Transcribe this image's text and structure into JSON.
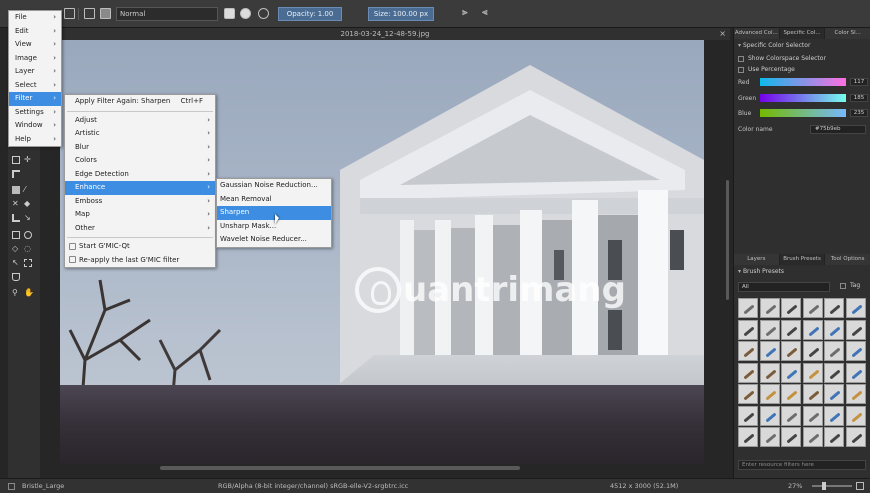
{
  "toolbar": {
    "blend_mode": "Normal",
    "opacity_label": "Opacity: 1.00",
    "size_label": "Size: 100.00 px"
  },
  "document": {
    "title": "2018-03-24_12-48-59.jpg"
  },
  "main_menu": {
    "items": [
      {
        "label": "File"
      },
      {
        "label": "Edit"
      },
      {
        "label": "View"
      },
      {
        "label": "Image"
      },
      {
        "label": "Layer"
      },
      {
        "label": "Select"
      },
      {
        "label": "Filter"
      },
      {
        "label": "Settings"
      },
      {
        "label": "Window"
      },
      {
        "label": "Help"
      }
    ],
    "selected": "Filter"
  },
  "filter_menu": {
    "apply_again": "Apply Filter Again: Sharpen",
    "apply_again_shortcut": "Ctrl+F",
    "items": [
      {
        "label": "Adjust"
      },
      {
        "label": "Artistic"
      },
      {
        "label": "Blur"
      },
      {
        "label": "Colors"
      },
      {
        "label": "Edge Detection"
      },
      {
        "label": "Enhance"
      },
      {
        "label": "Emboss"
      },
      {
        "label": "Map"
      },
      {
        "label": "Other"
      }
    ],
    "gmic_items": [
      {
        "label": "Start G'MIC-Qt"
      },
      {
        "label": "Re-apply the last G'MIC filter"
      }
    ]
  },
  "enhance_menu": {
    "items": [
      {
        "label": "Gaussian Noise Reduction..."
      },
      {
        "label": "Mean Removal"
      },
      {
        "label": "Sharpen"
      },
      {
        "label": "Unsharp Mask..."
      },
      {
        "label": "Wavelet Noise Reducer..."
      }
    ],
    "selected": "Sharpen"
  },
  "docker_top": {
    "tabs": [
      "Advanced Col...",
      "Specific Col...",
      "Color Sl..."
    ],
    "header": "Specific Color Selector",
    "show_colorspace": "Show Colorspace Selector",
    "use_percentage": "Use Percentage",
    "channels": [
      {
        "label": "Red",
        "value": "117",
        "color": "#d86fc0"
      },
      {
        "label": "Green",
        "value": "185",
        "color": "#5fc0d8"
      },
      {
        "label": "Blue",
        "value": "235",
        "color": "#7fa7e0"
      }
    ],
    "color_name_label": "Color name",
    "color_name_value": "#75b9eb"
  },
  "docker_bottom": {
    "tabs": [
      "Layers",
      "Brush Presets",
      "Tool Options"
    ],
    "header": "Brush Presets",
    "filter_value": "All",
    "tag_label": "Tag",
    "search_placeholder": "Enter resource filters here"
  },
  "statusbar": {
    "brush": "Bristle_Large",
    "color_info": "RGB/Alpha (8-bit integer/channel)  sRGB-elle-V2-srgbtrc.icc",
    "dimensions": "4512 x 3000 (52.1M)",
    "zoom": "27%"
  },
  "watermark": {
    "text": "uantrimang"
  }
}
